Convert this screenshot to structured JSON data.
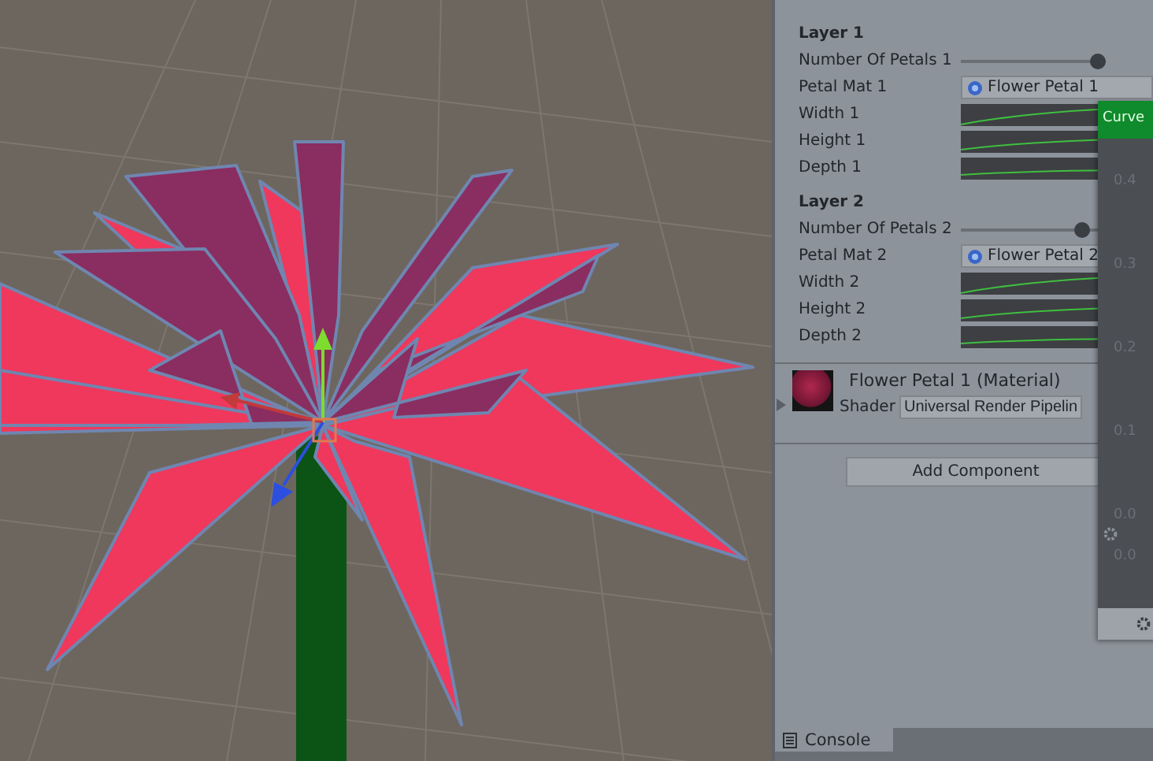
{
  "layers": [
    {
      "title": "Layer 1",
      "petals": {
        "label": "Number Of Petals 1",
        "level": 0.95
      },
      "material": {
        "label": "Petal Mat 1",
        "value": "Flower Petal 1"
      },
      "curves": [
        {
          "label": "Width 1"
        },
        {
          "label": "Height 1"
        },
        {
          "label": "Depth 1"
        }
      ]
    },
    {
      "title": "Layer 2",
      "petals": {
        "label": "Number Of Petals 2",
        "level": 0.84
      },
      "material": {
        "label": "Petal Mat 2",
        "value": "Flower Petal 2"
      },
      "curves": [
        {
          "label": "Width 2"
        },
        {
          "label": "Height 2"
        },
        {
          "label": "Depth 2"
        }
      ]
    }
  ],
  "material_section": {
    "title": "Flower Petal 1 (Material)",
    "shader_label": "Shader",
    "shader_value": "Universal Render Pipelin"
  },
  "add_component": "Add Component",
  "curve_popup": {
    "title": "Curve",
    "axis_labels": [
      "0.4",
      "0.3",
      "0.2",
      "0.1",
      "0.0"
    ],
    "bottom_label": "0.0"
  },
  "bottom_tabs": [
    {
      "label": "Console",
      "selected": true
    }
  ]
}
